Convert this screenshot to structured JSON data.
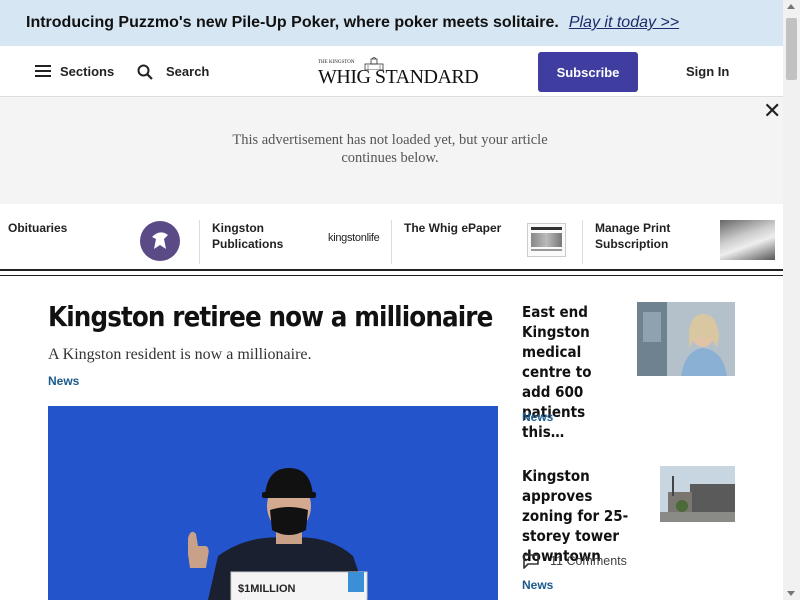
{
  "promo": {
    "text": "Introducing Puzzmo's new Pile-Up Poker, where poker meets solitaire.",
    "link": "Play it today >>"
  },
  "header": {
    "sections_label": "Sections",
    "search_label": "Search",
    "logo_small": "THE KINGSTON",
    "logo_main": "WHIG STANDARD",
    "subscribe_label": "Subscribe",
    "signin_label": "Sign In"
  },
  "ad": {
    "message": "This advertisement has not loaded yet, but your article continues below."
  },
  "strip": {
    "obituaries": "Obituaries",
    "kingston_publications": "Kingston Publications",
    "kingstonlife_logo": "kingstonlife",
    "epaper": "The Whig ePaper",
    "manage_print": "Manage Print Subscription"
  },
  "main_article": {
    "headline": "Kingston retiree now a millionaire",
    "deck": "A Kingston resident is now a millionaire.",
    "section": "News",
    "cheque_text": "$1MILLION"
  },
  "side_articles": [
    {
      "title": "East end Kingston medical centre to add 600 patients this…",
      "section": "News"
    },
    {
      "title": "Kingston approves zoning for 25-storey tower downtown",
      "comments": "11 Comments",
      "section": "News"
    }
  ],
  "colors": {
    "promo_bg": "#d6e7f3",
    "subscribe_bg": "#3f3da0",
    "tag": "#1b5a8c",
    "ad_bg": "#f4f4f4"
  }
}
